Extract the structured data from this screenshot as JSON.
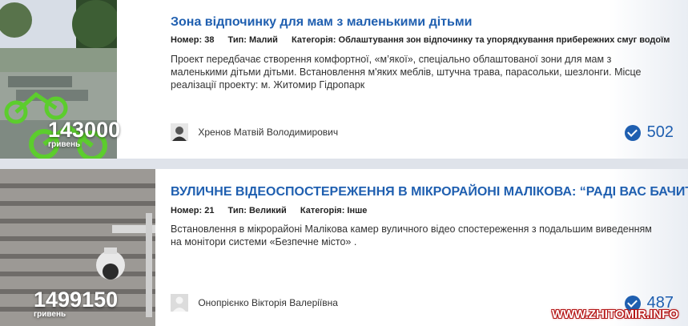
{
  "projects": [
    {
      "title": "Зона відпочинку для мам з маленькими дітьми",
      "number_label": "Номер:",
      "number": "38",
      "type_label": "Тип:",
      "type": "Малий",
      "category_label": "Категорія:",
      "category": "Облаштування зон відпочинку та упорядкування прибережних смуг водоїм",
      "description": "Проект передбачає створення комфортної, «м’якої», спеціально облаштованої зони для мам з маленькими дітьми дітьми. Встановлення м'яких меблів, штучна трава, парасольки, шезлонги. Місце реалізації проекту: м. Житомир Гідропарк",
      "amount": "143000",
      "currency": "гривень",
      "author": "Хренов Матвій Володимирович",
      "votes": "502"
    },
    {
      "title": "ВУЛИЧНЕ ВІДЕОСПОСТЕРЕЖЕННЯ В МІКРОРАЙОНІ МАЛІКОВА: “РАДІ ВАС БАЧИТИ!”",
      "number_label": "Номер:",
      "number": "21",
      "type_label": "Тип:",
      "type": "Великий",
      "category_label": "Категорія:",
      "category": "Інше",
      "description": "Встановлення в мікрорайоні Малікова камер вуличного відео спостереження з подальшим виведенням на монітори системи «Безпечне місто» .",
      "amount": "1499150",
      "currency": "гривень",
      "author": "Онопрієнко Вікторія Валеріївна",
      "votes": "487"
    }
  ],
  "watermark": "WWW.ZHITOMIR.INFO",
  "colors": {
    "accent": "#1f5fb0",
    "page_bg": "#dfe3ea",
    "watermark_outline": "#b41616"
  }
}
